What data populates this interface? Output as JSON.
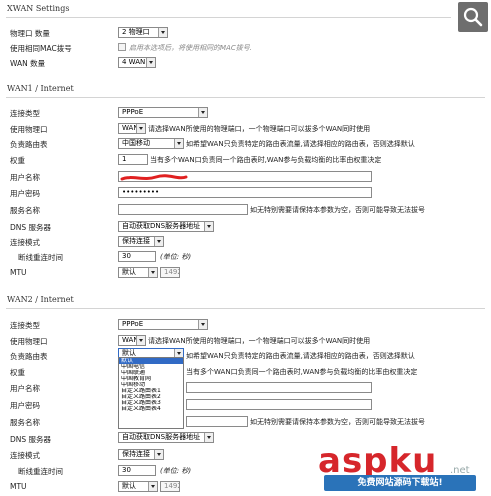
{
  "xwan": {
    "title": "XWAN Settings",
    "phys_count_label": "物理口 数量",
    "phys_count_value": "2 物理口",
    "same_mac_label": "使用相同MAC拨号",
    "same_mac_hint": "启用本选项后，将使用相同的MAC拨号.",
    "wan_count_label": "WAN 数量",
    "wan_count_value": "4 WAN"
  },
  "wan1": {
    "title": "WAN1 / Internet",
    "conn_type_label": "连接类型",
    "conn_type_value": "PPPoE",
    "phys_port_label": "使用物理口",
    "phys_port_value": "WAN",
    "phys_port_hint": "请选择WAN所使用的物理端口，一个物理端口可以拔多个WAN同时使用",
    "route_label": "负责路由表",
    "route_value": "中国移动",
    "route_hint": "如希望WAN只负责特定的路由表流量,请选择相应的路由表，否则选择默认",
    "weight_label": "权重",
    "weight_value": "1",
    "weight_hint": "当有多个WAN口负责同一个路由表时,WAN参与负载均衡的比率由权重决定",
    "user_label": "用户名称",
    "user_value": "",
    "pass_label": "用户密码",
    "pass_value": "•••••••••",
    "service_label": "服务名称",
    "service_value": "",
    "service_hint": "如无特别需要请保持本参数为空，否则可能导致无法拔号",
    "dns_label": "DNS 服务器",
    "dns_value": "自动获取DNS服务器地址",
    "mode_label": "连接模式",
    "mode_value": "保持连接",
    "reconnect_label": "断线重连时间",
    "reconnect_value": "30",
    "reconnect_unit": "(单位: 秒)",
    "mtu_label": "MTU",
    "mtu_value": "默认",
    "mtu_number": "1492"
  },
  "wan2": {
    "title": "WAN2 / Internet",
    "conn_type_label": "连接类型",
    "conn_type_value": "PPPoE",
    "phys_port_label": "使用物理口",
    "phys_port_value": "WAN",
    "phys_port_hint": "请选择WAN所使用的物理端口，一个物理端口可以拔多个WAN同时使用",
    "route_label": "负责路由表",
    "route_value": "默认",
    "route_hint": "如希望WAN只负责特定的路由表流量,请选择相应的路由表，否则选择默认",
    "weight_label": "权重",
    "weight_hint": "当有多个WAN口负责同一个路由表时,WAN参与负载均衡的比率由权重决定",
    "user_label": "用户名称",
    "pass_label": "用户密码",
    "service_label": "服务名称",
    "service_hint": "如无特别需要请保持本参数为空，否则可能导致无法拔号",
    "dns_label": "DNS 服务器",
    "dns_value": "自动获取DNS服务器地址",
    "mode_label": "连接模式",
    "mode_value": "保持连接",
    "reconnect_label": "断线重连时间",
    "reconnect_value": "30",
    "reconnect_unit": "(单位: 秒)",
    "mtu_label": "MTU",
    "mtu_value": "默认",
    "mtu_number": "1492",
    "route_options": [
      "默认",
      "中国电信",
      "中国联通",
      "中国教育网",
      "中国移动",
      "自定义路由表1",
      "自定义路由表2",
      "自定义路由表3",
      "自定义路由表4"
    ]
  },
  "watermark": {
    "brand": "aspku",
    "domain": ".net",
    "subtitle": "免费网站源码下载站!"
  },
  "colors": {
    "dropdown_highlight": "#316ac5",
    "watermark_red": "#d6262b",
    "watermark_blue": "#2a73b9",
    "search_bg": "#6e6e6e"
  },
  "icons": {
    "search": "search-icon",
    "dropdown_arrow": "chevron-down-icon"
  }
}
